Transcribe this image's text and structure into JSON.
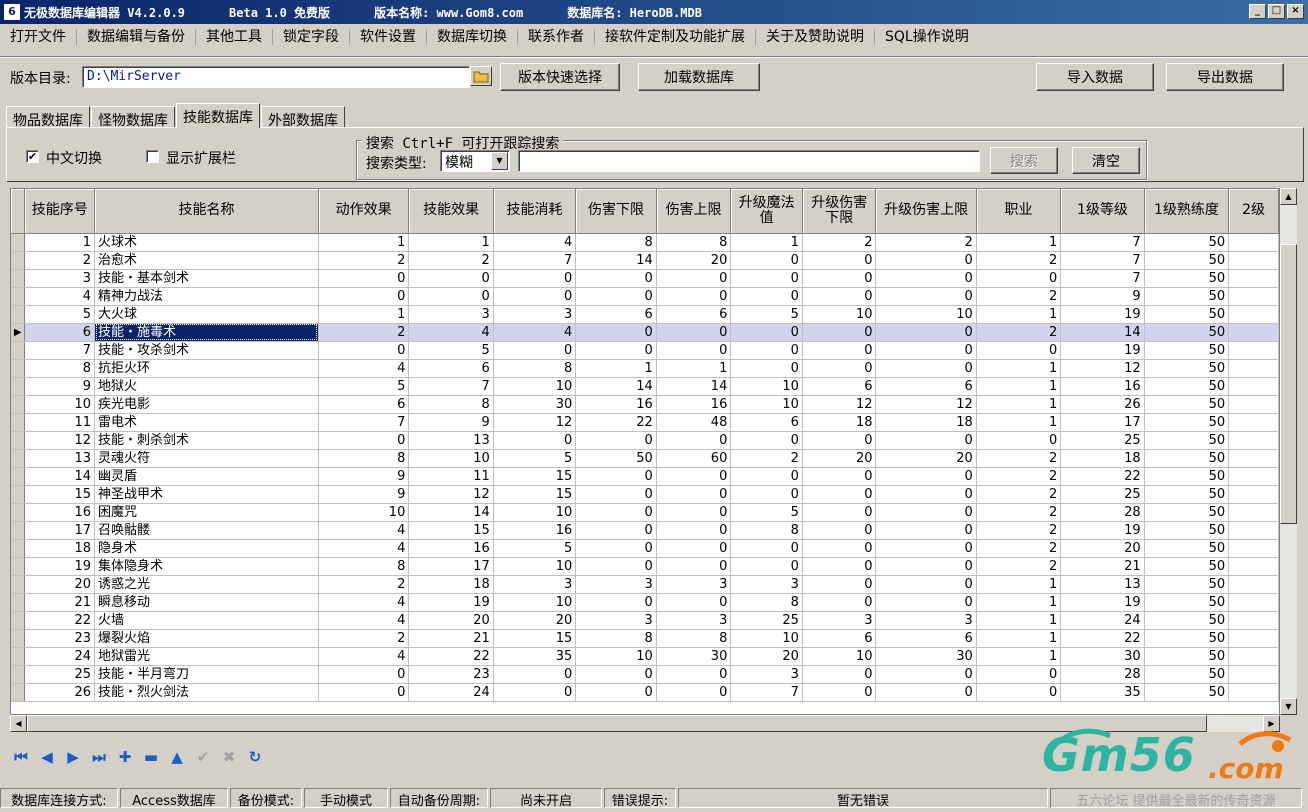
{
  "window": {
    "title_segments": [
      "无极数据库编辑器 V4.2.0.9",
      "Beta 1.0 免费版",
      "版本名称: www.Gom8.com",
      "数据库名: HeroDB.MDB"
    ],
    "buttons": [
      "_",
      "□",
      "×"
    ]
  },
  "menu": [
    "打开文件",
    "数据编辑与备份",
    "其他工具",
    "锁定字段",
    "软件设置",
    "数据库切换",
    "联系作者",
    "接软件定制及功能扩展",
    "关于及赞助说明",
    "SQL操作说明"
  ],
  "toolbar": {
    "dir_label": "版本目录:",
    "dir_value": "D:\\MirServer",
    "quick_select": "版本快速选择",
    "load_db": "加载数据库",
    "import": "导入数据",
    "export": "导出数据"
  },
  "tabs": [
    {
      "label": "物品数据库",
      "active": false
    },
    {
      "label": "怪物数据库",
      "active": false
    },
    {
      "label": "技能数据库",
      "active": true
    },
    {
      "label": "外部数据库",
      "active": false
    }
  ],
  "options": {
    "chinese_toggle": {
      "label": "中文切换",
      "checked": true
    },
    "show_ext": {
      "label": "显示扩展栏",
      "checked": false
    }
  },
  "search": {
    "group_title": "搜索  Ctrl+F 可打开跟踪搜索",
    "type_label": "搜索类型:",
    "type_value": "模糊",
    "query": "",
    "search_btn": "搜索",
    "clear_btn": "清空"
  },
  "grid": {
    "columns": [
      "技能序号",
      "技能名称",
      "动作效果",
      "技能效果",
      "技能消耗",
      "伤害下限",
      "伤害上限",
      "升级魔法值",
      "升级伤害下限",
      "升级伤害上限",
      "职业",
      "1级等级",
      "1级熟练度",
      "2级"
    ],
    "selected_row": 5,
    "rows": [
      [
        "1",
        "火球术",
        "1",
        "1",
        "4",
        "8",
        "8",
        "1",
        "2",
        "2",
        "1",
        "7",
        "50"
      ],
      [
        "2",
        "治愈术",
        "2",
        "2",
        "7",
        "14",
        "20",
        "0",
        "0",
        "0",
        "2",
        "7",
        "50"
      ],
      [
        "3",
        "技能・基本剑术",
        "0",
        "0",
        "0",
        "0",
        "0",
        "0",
        "0",
        "0",
        "0",
        "7",
        "50"
      ],
      [
        "4",
        "精神力战法",
        "0",
        "0",
        "0",
        "0",
        "0",
        "0",
        "0",
        "0",
        "2",
        "9",
        "50"
      ],
      [
        "5",
        "大火球",
        "1",
        "3",
        "3",
        "6",
        "6",
        "5",
        "10",
        "10",
        "1",
        "19",
        "50"
      ],
      [
        "6",
        "技能・施毒术",
        "2",
        "4",
        "4",
        "0",
        "0",
        "0",
        "0",
        "0",
        "2",
        "14",
        "50"
      ],
      [
        "7",
        "技能・攻杀剑术",
        "0",
        "5",
        "0",
        "0",
        "0",
        "0",
        "0",
        "0",
        "0",
        "19",
        "50"
      ],
      [
        "8",
        "抗拒火环",
        "4",
        "6",
        "8",
        "1",
        "1",
        "0",
        "0",
        "0",
        "1",
        "12",
        "50"
      ],
      [
        "9",
        "地狱火",
        "5",
        "7",
        "10",
        "14",
        "14",
        "10",
        "6",
        "6",
        "1",
        "16",
        "50"
      ],
      [
        "10",
        "疾光电影",
        "6",
        "8",
        "30",
        "16",
        "16",
        "10",
        "12",
        "12",
        "1",
        "26",
        "50"
      ],
      [
        "11",
        "雷电术",
        "7",
        "9",
        "12",
        "22",
        "48",
        "6",
        "18",
        "18",
        "1",
        "17",
        "50"
      ],
      [
        "12",
        "技能・刺杀剑术",
        "0",
        "13",
        "0",
        "0",
        "0",
        "0",
        "0",
        "0",
        "0",
        "25",
        "50"
      ],
      [
        "13",
        "灵魂火符",
        "8",
        "10",
        "5",
        "50",
        "60",
        "2",
        "20",
        "20",
        "2",
        "18",
        "50"
      ],
      [
        "14",
        "幽灵盾",
        "9",
        "11",
        "15",
        "0",
        "0",
        "0",
        "0",
        "0",
        "2",
        "22",
        "50"
      ],
      [
        "15",
        "神圣战甲术",
        "9",
        "12",
        "15",
        "0",
        "0",
        "0",
        "0",
        "0",
        "2",
        "25",
        "50"
      ],
      [
        "16",
        "困魔咒",
        "10",
        "14",
        "10",
        "0",
        "0",
        "5",
        "0",
        "0",
        "2",
        "28",
        "50"
      ],
      [
        "17",
        "召唤骷髅",
        "4",
        "15",
        "16",
        "0",
        "0",
        "8",
        "0",
        "0",
        "2",
        "19",
        "50"
      ],
      [
        "18",
        "隐身术",
        "4",
        "16",
        "5",
        "0",
        "0",
        "0",
        "0",
        "0",
        "2",
        "20",
        "50"
      ],
      [
        "19",
        "集体隐身术",
        "8",
        "17",
        "10",
        "0",
        "0",
        "0",
        "0",
        "0",
        "2",
        "21",
        "50"
      ],
      [
        "20",
        "诱惑之光",
        "2",
        "18",
        "3",
        "3",
        "3",
        "3",
        "0",
        "0",
        "1",
        "13",
        "50"
      ],
      [
        "21",
        "瞬息移动",
        "4",
        "19",
        "10",
        "0",
        "0",
        "8",
        "0",
        "0",
        "1",
        "19",
        "50"
      ],
      [
        "22",
        "火墙",
        "4",
        "20",
        "20",
        "3",
        "3",
        "25",
        "3",
        "3",
        "1",
        "24",
        "50"
      ],
      [
        "23",
        "爆裂火焰",
        "2",
        "21",
        "15",
        "8",
        "8",
        "10",
        "6",
        "6",
        "1",
        "22",
        "50"
      ],
      [
        "24",
        "地狱雷光",
        "4",
        "22",
        "35",
        "10",
        "30",
        "20",
        "10",
        "30",
        "1",
        "30",
        "50"
      ],
      [
        "25",
        "技能・半月弯刀",
        "0",
        "23",
        "0",
        "0",
        "0",
        "3",
        "0",
        "0",
        "0",
        "28",
        "50"
      ],
      [
        "26",
        "技能・烈火剑法",
        "0",
        "24",
        "0",
        "0",
        "0",
        "7",
        "0",
        "0",
        "0",
        "35",
        "50"
      ]
    ]
  },
  "navigator": [
    {
      "name": "first",
      "glyph": "⏮",
      "enabled": true
    },
    {
      "name": "prior",
      "glyph": "◀",
      "enabled": true
    },
    {
      "name": "next",
      "glyph": "▶",
      "enabled": true
    },
    {
      "name": "last",
      "glyph": "⏭",
      "enabled": true
    },
    {
      "name": "insert",
      "glyph": "✚",
      "enabled": true
    },
    {
      "name": "delete",
      "glyph": "▬",
      "enabled": true
    },
    {
      "name": "edit",
      "glyph": "▲",
      "enabled": true
    },
    {
      "name": "post",
      "glyph": "✔",
      "enabled": false
    },
    {
      "name": "cancel",
      "glyph": "✖",
      "enabled": false
    },
    {
      "name": "refresh",
      "glyph": "↻",
      "enabled": true
    }
  ],
  "status": [
    "数据库连接方式:",
    "Access数据库",
    "备份模式:",
    "手动模式",
    "自动备份周期:",
    "尚未开启",
    "错误提示:",
    "暂无错误",
    "五六论坛 提供最全最新的传奇资源"
  ],
  "watermark": {
    "logo": "Gm56",
    "suffix": ".com"
  },
  "colors": {
    "title_start": "#0a246a",
    "selection": "#0a246a",
    "selected_row_bg": "#d3d3eb",
    "nav_blue": "#1a5fc8",
    "wm_green": "#2bb5a0",
    "wm_orange": "#f07a10"
  }
}
